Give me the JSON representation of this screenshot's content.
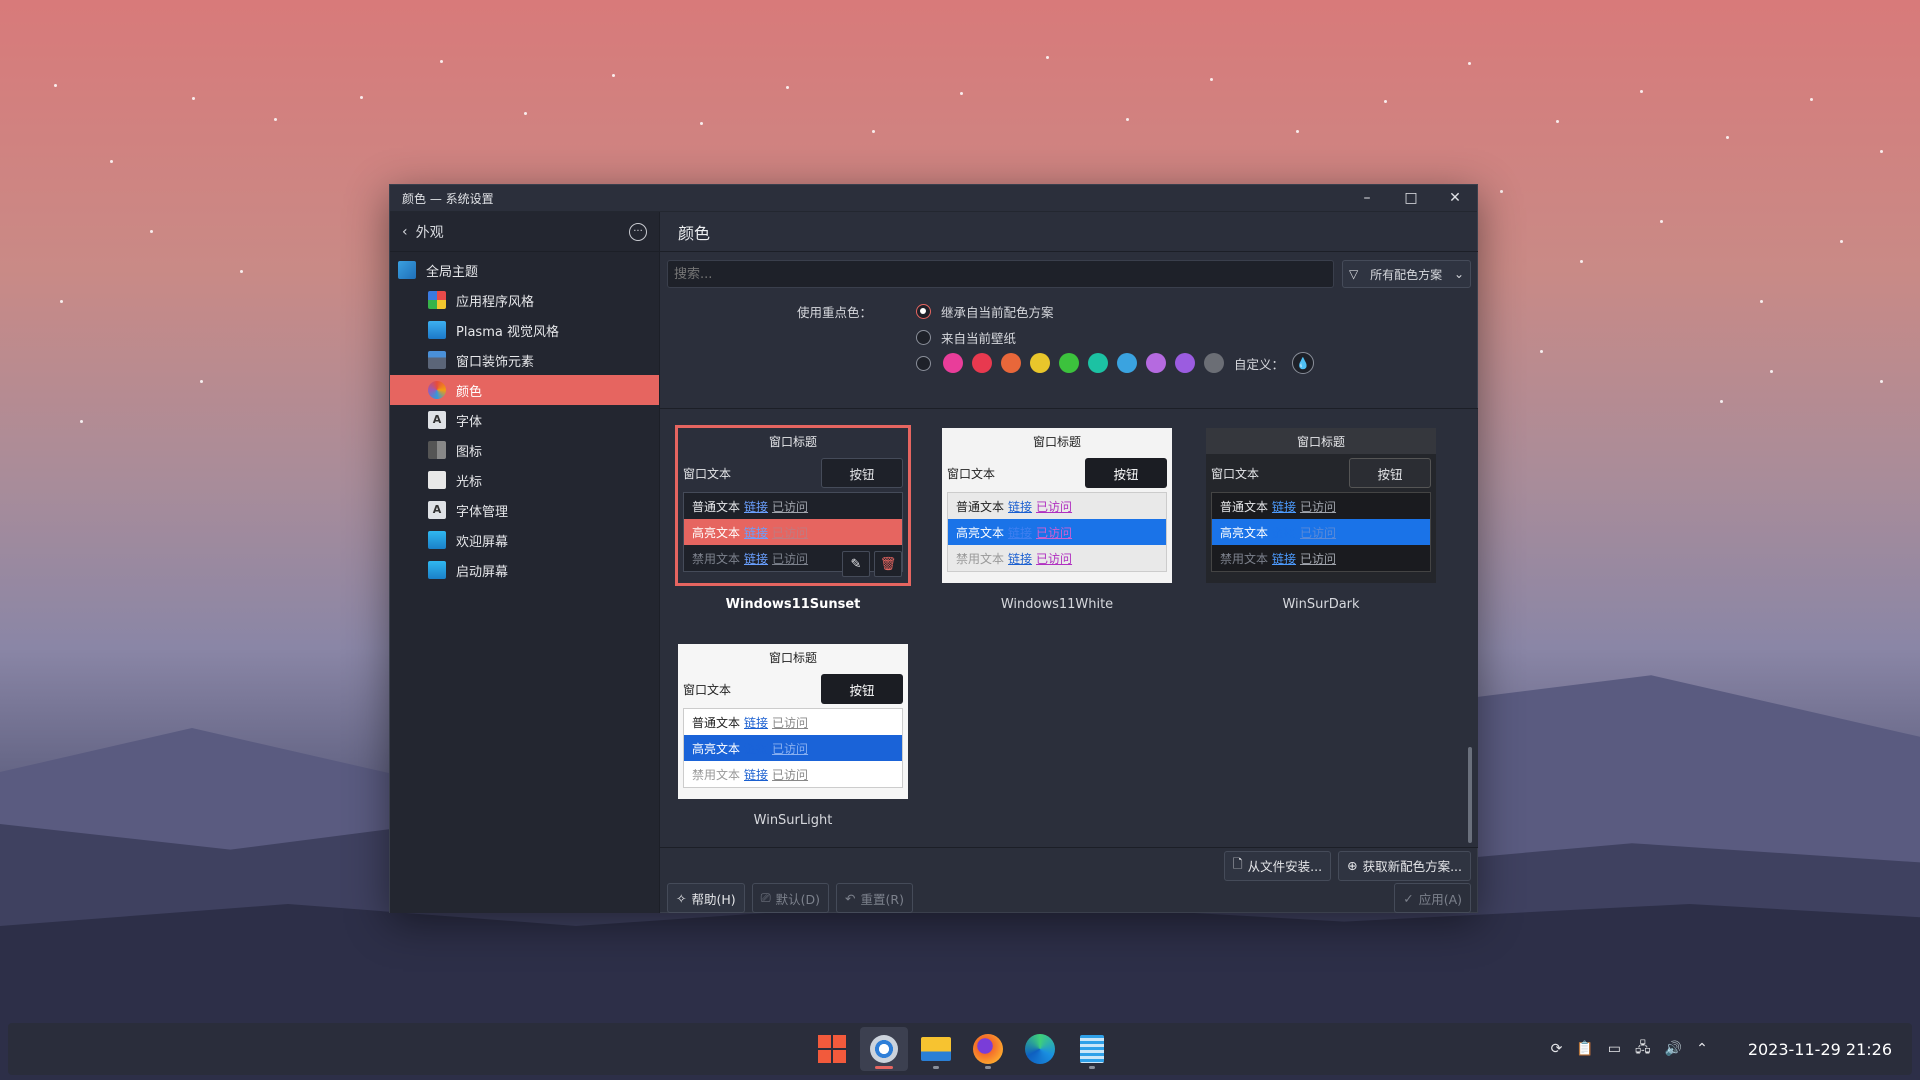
{
  "window": {
    "title": "颜色 — 系统设置",
    "minimize": "–",
    "maximize": "□",
    "close": "✕"
  },
  "sidebar": {
    "back_label": "外观",
    "items": [
      {
        "label": "全局主题",
        "icon": "globe-icon"
      },
      {
        "label": "应用程序风格",
        "icon": "app-style-icon"
      },
      {
        "label": "Plasma 视觉风格",
        "icon": "plasma-icon"
      },
      {
        "label": "窗口装饰元素",
        "icon": "window-decoration-icon"
      },
      {
        "label": "颜色",
        "icon": "color-icon"
      },
      {
        "label": "字体",
        "icon": "font-icon"
      },
      {
        "label": "图标",
        "icon": "icons-icon"
      },
      {
        "label": "光标",
        "icon": "cursor-icon"
      },
      {
        "label": "字体管理",
        "icon": "font-manager-icon"
      },
      {
        "label": "欢迎屏幕",
        "icon": "welcome-screen-icon"
      },
      {
        "label": "启动屏幕",
        "icon": "splash-screen-icon"
      }
    ],
    "active_index": 4
  },
  "main": {
    "title": "颜色",
    "search_placeholder": "搜索...",
    "filter_label": "所有配色方案",
    "accent": {
      "label": "使用重点色：",
      "option_inherit": "继承自当前配色方案",
      "option_wallpaper": "来自当前壁纸",
      "custom_label": "自定义：",
      "colors": [
        "#e93d9a",
        "#e8394f",
        "#e8673a",
        "#e9c62b",
        "#3cc23d",
        "#1cc2a3",
        "#3aa3e0",
        "#b56ae0",
        "#9b5ce0",
        "#6b6e75"
      ]
    },
    "schemes": [
      {
        "name": "Windows11Sunset",
        "selected": true,
        "title": "窗口标题",
        "window_text": "窗口文本",
        "button": "按钮",
        "normal": "普通文本",
        "link": "链接",
        "visited": "已访问",
        "highlight": "高亮文本",
        "disabled": "禁用文本"
      },
      {
        "name": "Windows11White",
        "selected": false,
        "title": "窗口标题",
        "window_text": "窗口文本",
        "button": "按钮",
        "normal": "普通文本",
        "link": "链接",
        "visited": "已访问",
        "highlight": "高亮文本",
        "disabled": "禁用文本"
      },
      {
        "name": "WinSurDark",
        "selected": false,
        "title": "窗口标题",
        "window_text": "窗口文本",
        "button": "按钮",
        "normal": "普通文本",
        "link": "链接",
        "visited": "已访问",
        "highlight": "高亮文本",
        "disabled": "禁用文本"
      },
      {
        "name": "WinSurLight",
        "selected": false,
        "title": "窗口标题",
        "window_text": "窗口文本",
        "button": "按钮",
        "normal": "普通文本",
        "link": "链接",
        "visited": "已访问",
        "highlight": "高亮文本",
        "disabled": "禁用文本"
      }
    ],
    "install_from_file": "从文件安装...",
    "get_new": "获取新配色方案...",
    "help": "帮助(H)",
    "defaults": "默认(D)",
    "reset": "重置(R)",
    "apply": "应用(A)"
  },
  "taskbar": {
    "apps": [
      "start-menu-icon",
      "system-settings-icon",
      "file-manager-icon",
      "firefox-icon",
      "edge-icon",
      "notes-icon"
    ],
    "clock": "2023-11-29 21:26"
  },
  "colors": {
    "accent": "#e66560",
    "highlight_blue": "#1a73e8"
  }
}
